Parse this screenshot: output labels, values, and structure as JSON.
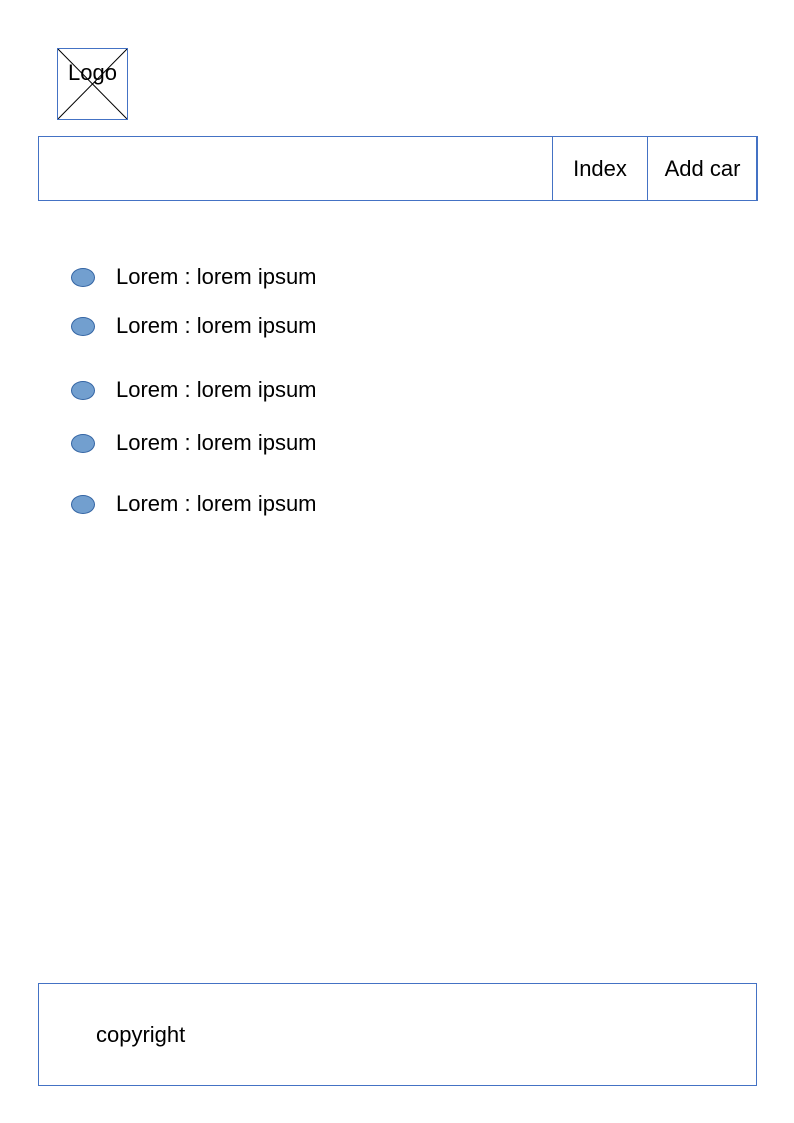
{
  "header": {
    "logo_text": "Logo"
  },
  "nav": {
    "items": [
      {
        "label": "Index"
      },
      {
        "label": "Add car"
      }
    ]
  },
  "content": {
    "items": [
      {
        "text": "Lorem : lorem ipsum"
      },
      {
        "text": "Lorem : lorem ipsum"
      },
      {
        "text": "Lorem : lorem ipsum"
      },
      {
        "text": "Lorem : lorem ipsum"
      },
      {
        "text": "Lorem : lorem ipsum"
      }
    ]
  },
  "footer": {
    "text": "copyright"
  },
  "colors": {
    "border": "#4472c4",
    "bullet_fill": "#729fcf",
    "bullet_stroke": "#3465a4"
  }
}
